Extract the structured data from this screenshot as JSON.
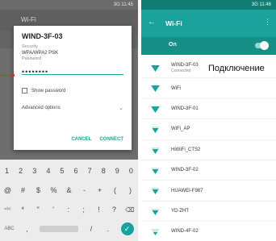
{
  "status": {
    "left_time": "3G 11:45",
    "right_time": "3G 11:46"
  },
  "left_screen": {
    "appbar_title": "Wi-Fi",
    "dialog": {
      "title": "WIND-3F-03",
      "security_label": "Security",
      "security_value": "WPA/WPA2 PSK",
      "password_label": "Password",
      "password_value": "••••••••",
      "show_password_label": "Show password",
      "advanced_label": "Advanced options",
      "cancel_label": "CANCEL",
      "connect_label": "CONNECT"
    },
    "keyboard": {
      "row1": [
        "1",
        "2",
        "3",
        "4",
        "5",
        "6",
        "7",
        "8",
        "9",
        "0"
      ],
      "row2": [
        "@",
        "#",
        "$",
        "%",
        "&",
        "-",
        "+",
        "(",
        ")"
      ],
      "row3": [
        "=\\<",
        "*",
        "\"",
        "'",
        ":",
        ";",
        "!",
        "?"
      ],
      "row4": [
        "ABC",
        ",",
        "/",
        "."
      ]
    }
  },
  "right_screen": {
    "title": "Wi-Fi",
    "on_label": "On",
    "networks": [
      {
        "name": "WIND-3F-03",
        "status": "Connected",
        "strength": 4
      },
      {
        "name": "WiFi",
        "status": "",
        "strength": 4
      },
      {
        "name": "WIND-3F-01",
        "status": "",
        "strength": 4
      },
      {
        "name": "WiFi_AP",
        "status": "",
        "strength": 3
      },
      {
        "name": "HiWiFi_CTS2",
        "status": "",
        "strength": 3
      },
      {
        "name": "WIND-3F-02",
        "status": "",
        "strength": 3
      },
      {
        "name": "HUAWEI-F987",
        "status": "",
        "strength": 3
      },
      {
        "name": "YD-ZHT",
        "status": "",
        "strength": 3
      },
      {
        "name": "WIND-4F-02",
        "status": "",
        "strength": 2
      }
    ]
  },
  "annotation": {
    "callout_text": "Подключение"
  },
  "colors": {
    "accent": "#1aa39a",
    "accent_dark": "#137d75",
    "callout": "#c0392b"
  }
}
